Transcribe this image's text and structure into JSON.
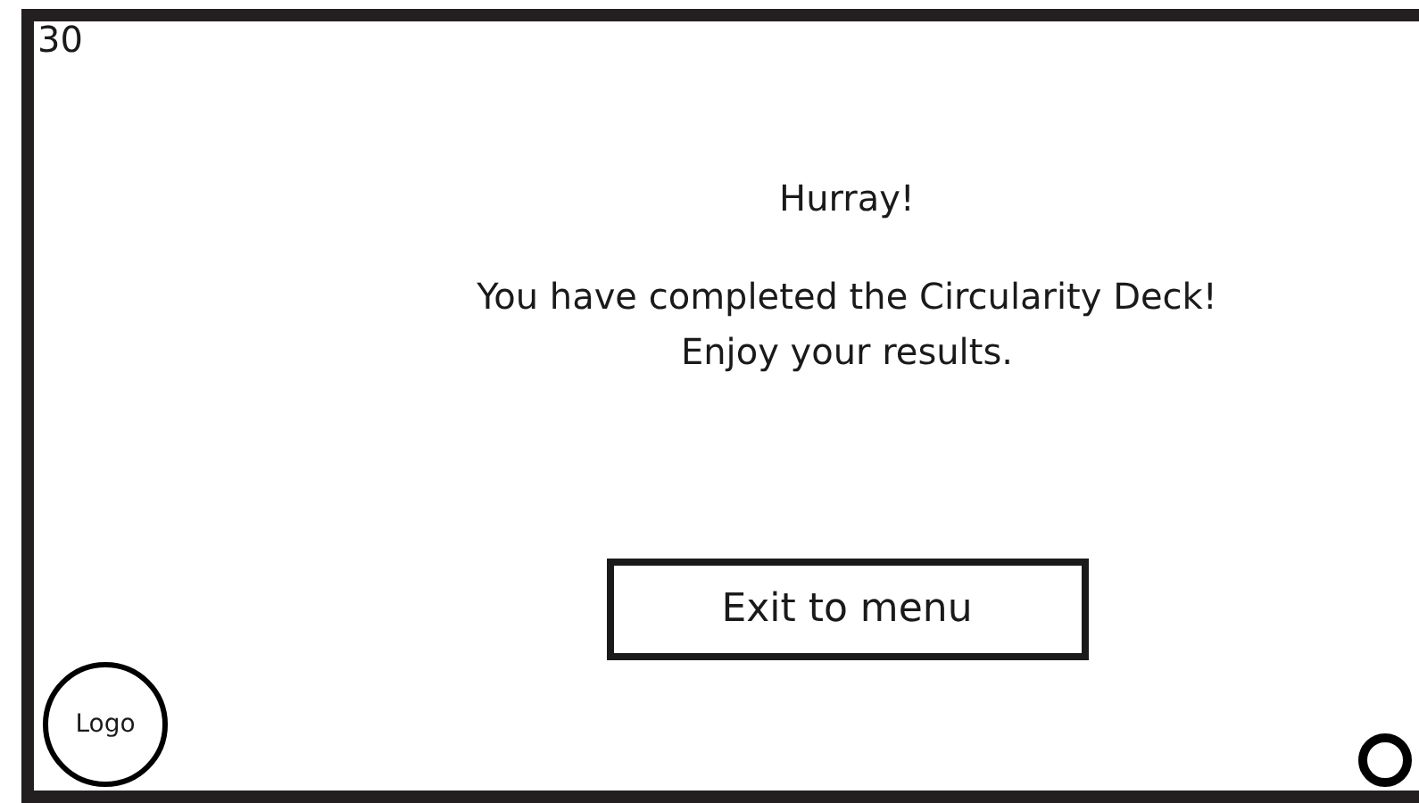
{
  "counter": "30",
  "title": "Hurray!",
  "message": [
    "You have completed the Circularity Deck!",
    "Enjoy your results."
  ],
  "exit_button": "Exit to menu",
  "logo": "Logo"
}
